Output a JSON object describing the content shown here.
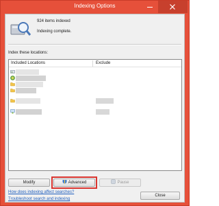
{
  "window": {
    "title": "Indexing Options"
  },
  "status": {
    "items_indexed": "924 items indexed",
    "state": "Indexing complete."
  },
  "locations": {
    "section_label": "Index these locations:",
    "columns": {
      "included": "Included Locations",
      "exclude": "Exclude"
    },
    "rows": [
      {
        "icon": "drive-icon",
        "redacted": true
      },
      {
        "icon": "library-icon",
        "redacted": true
      },
      {
        "icon": "folder-icon",
        "redacted": true
      },
      {
        "icon": "folder-icon",
        "redacted": true
      },
      {
        "icon": "folder-icon",
        "redacted": true
      },
      {
        "icon": "network-icon",
        "redacted": true
      }
    ]
  },
  "buttons": {
    "modify": "Modify",
    "advanced": "Advanced",
    "pause": "Pause",
    "close": "Close"
  },
  "links": {
    "how_indexing": "How does indexing affect searches?",
    "troubleshoot": "Troubleshoot search and indexing"
  },
  "colors": {
    "title_bar": "#e6503a",
    "highlight": "#d9352f",
    "link": "#1f5fbf"
  }
}
